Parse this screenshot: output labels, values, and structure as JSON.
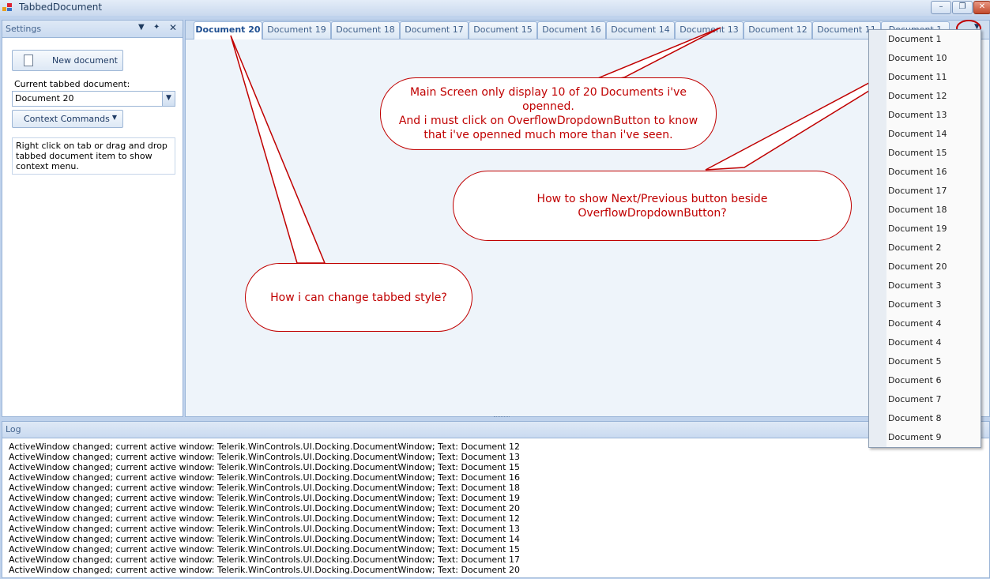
{
  "window": {
    "title": "TabbedDocument",
    "minimize_glyph": "–",
    "restore_glyph": "❐",
    "close_glyph": "✕"
  },
  "settings": {
    "title": "Settings",
    "new_document_label": "New document",
    "current_label": "Current tabbed document:",
    "current_value": "Document 20",
    "context_commands_label": "Context Commands",
    "info_text": "Right click on tab or drag and drop tabbed document item to show context menu.",
    "header_icons": {
      "dropdown": "▼",
      "pin": "✦",
      "close": "✕"
    }
  },
  "tabs": [
    "Document 20",
    "Document 19",
    "Document 18",
    "Document 17",
    "Document 15",
    "Document 16",
    "Document 14",
    "Document 13",
    "Document 12",
    "Document 11",
    "Document 1"
  ],
  "active_tab": "Document 20",
  "overflow_menu": [
    "Document 1",
    "Document 10",
    "Document 11",
    "Document 12",
    "Document 13",
    "Document 14",
    "Document 15",
    "Document 16",
    "Document 17",
    "Document 18",
    "Document 19",
    "Document 2",
    "Document 20",
    "Document 3",
    "Document 3",
    "Document 4",
    "Document 4",
    "Document 5",
    "Document 6",
    "Document 7",
    "Document 8",
    "Document 9"
  ],
  "log": {
    "title": "Log",
    "lines": [
      "ActiveWindow changed; current active window: Telerik.WinControls.UI.Docking.DocumentWindow; Text: Document 12",
      "ActiveWindow changed; current active window: Telerik.WinControls.UI.Docking.DocumentWindow; Text: Document 13",
      "ActiveWindow changed; current active window: Telerik.WinControls.UI.Docking.DocumentWindow; Text: Document 15",
      "ActiveWindow changed; current active window: Telerik.WinControls.UI.Docking.DocumentWindow; Text: Document 16",
      "ActiveWindow changed; current active window: Telerik.WinControls.UI.Docking.DocumentWindow; Text: Document 18",
      "ActiveWindow changed; current active window: Telerik.WinControls.UI.Docking.DocumentWindow; Text: Document 19",
      "ActiveWindow changed; current active window: Telerik.WinControls.UI.Docking.DocumentWindow; Text: Document 20",
      "ActiveWindow changed; current active window: Telerik.WinControls.UI.Docking.DocumentWindow; Text: Document 12",
      "ActiveWindow changed; current active window: Telerik.WinControls.UI.Docking.DocumentWindow; Text: Document 13",
      "ActiveWindow changed; current active window: Telerik.WinControls.UI.Docking.DocumentWindow; Text: Document 14",
      "ActiveWindow changed; current active window: Telerik.WinControls.UI.Docking.DocumentWindow; Text: Document 15",
      "ActiveWindow changed; current active window: Telerik.WinControls.UI.Docking.DocumentWindow; Text: Document 17",
      "ActiveWindow changed; current active window: Telerik.WinControls.UI.Docking.DocumentWindow; Text: Document 20"
    ]
  },
  "callouts": {
    "main_screen": "Main Screen only display 10 of 20 Documents i've openned.\nAnd i must click on OverflowDropdownButton to know that i've openned much more than i've seen.",
    "next_prev": "How to show Next/Previous button beside OverflowDropdownButton?",
    "tab_style": "How i can change tabbed style?"
  },
  "colors": {
    "callout": "#c00000",
    "accent": "#99b4d7"
  }
}
